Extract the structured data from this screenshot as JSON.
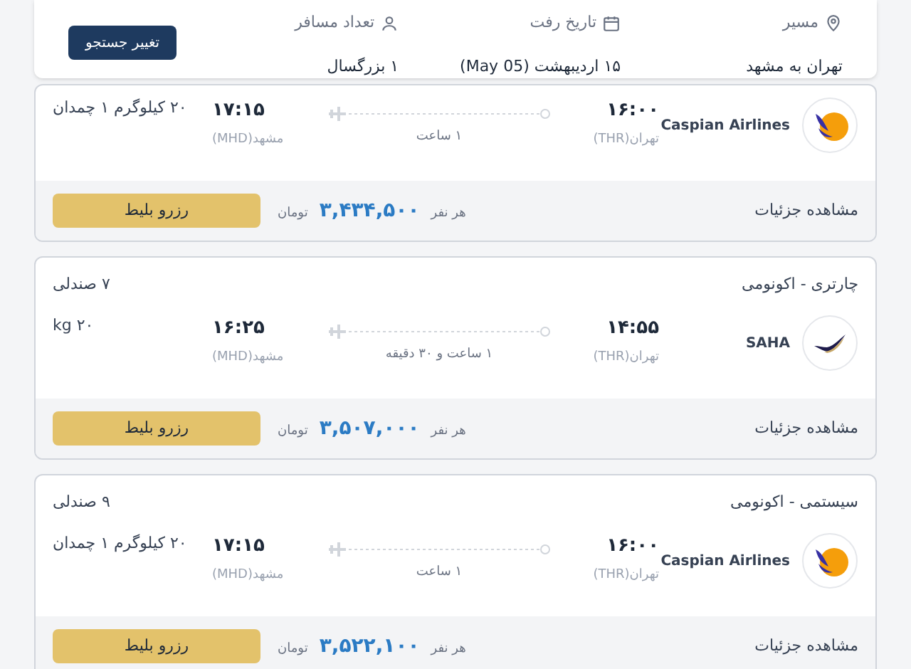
{
  "search_summary": {
    "fields": [
      {
        "kind": "route",
        "label": "مسیر",
        "value": "تهران به مشهد"
      },
      {
        "kind": "date",
        "label": "تاریخ رفت",
        "value": "۱۵ اردیبهشت (May 05)"
      },
      {
        "kind": "passengers",
        "label": "تعداد مسافر",
        "value": "۱ بزرگسال"
      }
    ],
    "change_button": "تغییر جستجو"
  },
  "flights": [
    {
      "logo": {
        "kind": "caspian"
      },
      "airline": "Caspian Airlines",
      "departure_time": "۱۶:۰۰",
      "departure_city": "تهران(THR)",
      "duration": "۱ ساعت",
      "arrival_time": "۱۷:۱۵",
      "arrival_city": "مشهد(MHD)",
      "baggage": "۲۰ کیلوگرم ۱ چمدان",
      "details_link": "مشاهده جزئیات",
      "per_person": "هر نفر",
      "price": "۳,۴۳۴,۵۰۰",
      "currency": "تومان",
      "book_button": "رزرو بلیط"
    },
    {
      "fare_class": "چارتری - اکونومی",
      "seats": "۷ صندلی",
      "logo": {
        "kind": "saha"
      },
      "airline": "SAHA",
      "departure_time": "۱۴:۵۵",
      "departure_city": "تهران(THR)",
      "duration": "۱ ساعت و ۳۰ دقیقه",
      "arrival_time": "۱۶:۲۵",
      "arrival_city": "مشهد(MHD)",
      "baggage": "kg ۲۰",
      "details_link": "مشاهده جزئیات",
      "per_person": "هر نفر",
      "price": "۳,۵۰۷,۰۰۰",
      "currency": "تومان",
      "book_button": "رزرو بلیط"
    },
    {
      "fare_class": "سیستمی - اکونومی",
      "seats": "۹ صندلی",
      "logo": {
        "kind": "caspian"
      },
      "airline": "Caspian Airlines",
      "departure_time": "۱۶:۰۰",
      "departure_city": "تهران(THR)",
      "duration": "۱ ساعت",
      "arrival_time": "۱۷:۱۵",
      "arrival_city": "مشهد(MHD)",
      "baggage": "۲۰ کیلوگرم ۱ چمدان",
      "details_link": "مشاهده جزئیات",
      "per_person": "هر نفر",
      "price": "۳,۵۲۲,۱۰۰",
      "currency": "تومان",
      "book_button": "رزرو بلیط"
    }
  ]
}
